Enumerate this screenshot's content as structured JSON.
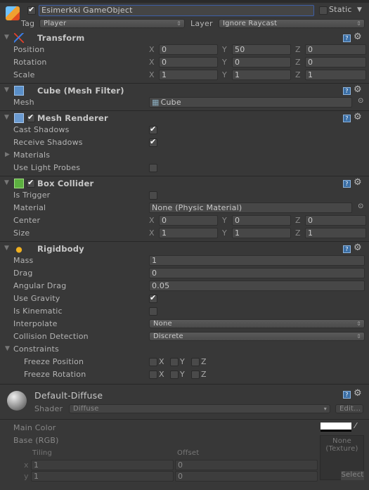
{
  "header": {
    "active": true,
    "name": "Esimerkki GameObject",
    "static_label": "Static",
    "static": false,
    "tag_label": "Tag",
    "tag": "Player",
    "layer_label": "Layer",
    "layer": "Ignore Raycast"
  },
  "components": [
    {
      "title": "Transform",
      "icon": "transform-axes-icon",
      "rows": [
        {
          "type": "vector",
          "label": "Position",
          "x": "0",
          "y": "50",
          "z": "0"
        },
        {
          "type": "vector",
          "label": "Rotation",
          "x": "0",
          "y": "0",
          "z": "0"
        },
        {
          "type": "vector",
          "label": "Scale",
          "x": "1",
          "y": "1",
          "z": "1"
        }
      ]
    },
    {
      "title": "Cube (Mesh Filter)",
      "icon": "mesh-filter-icon",
      "rows": [
        {
          "type": "object",
          "label": "Mesh",
          "value": "Cube"
        }
      ]
    },
    {
      "title": "Mesh Renderer",
      "icon": "mesh-renderer-icon",
      "enabled": true,
      "rows": [
        {
          "type": "check",
          "label": "Cast Shadows",
          "checked": true
        },
        {
          "type": "check",
          "label": "Receive Shadows",
          "checked": true
        },
        {
          "type": "foldout",
          "label": "Materials",
          "expanded": false
        },
        {
          "type": "check",
          "label": "Use Light Probes",
          "checked": false
        }
      ]
    },
    {
      "title": "Box Collider",
      "icon": "box-collider-icon",
      "enabled": true,
      "rows": [
        {
          "type": "check",
          "label": "Is Trigger",
          "checked": false
        },
        {
          "type": "object",
          "label": "Material",
          "value": "None (Physic Material)"
        },
        {
          "type": "vector",
          "label": "Center",
          "x": "0",
          "y": "0",
          "z": "0"
        },
        {
          "type": "vector",
          "label": "Size",
          "x": "1",
          "y": "1",
          "z": "1"
        }
      ]
    },
    {
      "title": "Rigidbody",
      "icon": "rigidbody-icon",
      "rows": [
        {
          "type": "text",
          "label": "Mass",
          "value": "1"
        },
        {
          "type": "text",
          "label": "Drag",
          "value": "0"
        },
        {
          "type": "text",
          "label": "Angular Drag",
          "value": "0.05"
        },
        {
          "type": "check",
          "label": "Use Gravity",
          "checked": true
        },
        {
          "type": "check",
          "label": "Is Kinematic",
          "checked": false
        },
        {
          "type": "dropdown",
          "label": "Interpolate",
          "value": "None"
        },
        {
          "type": "dropdown",
          "label": "Collision Detection",
          "value": "Discrete"
        },
        {
          "type": "foldout",
          "label": "Constraints",
          "expanded": true
        },
        {
          "type": "flags",
          "label": "Freeze Position",
          "items": [
            "X",
            "Y",
            "Z"
          ]
        },
        {
          "type": "flags",
          "label": "Freeze Rotation",
          "items": [
            "X",
            "Y",
            "Z"
          ]
        }
      ]
    }
  ],
  "material": {
    "name": "Default-Diffuse",
    "shader_label": "Shader",
    "shader": "Diffuse",
    "edit_label": "Edit...",
    "main_color_label": "Main Color",
    "main_color": "#ffffff",
    "base_label": "Base (RGB)",
    "texture_none": "None\n(Texture)",
    "select_label": "Select",
    "tiling_label": "Tiling",
    "offset_label": "Offset",
    "x_label": "x",
    "y_label": "y",
    "tiling_x": "1",
    "tiling_y": "1",
    "offset_x": "0",
    "offset_y": "0"
  }
}
